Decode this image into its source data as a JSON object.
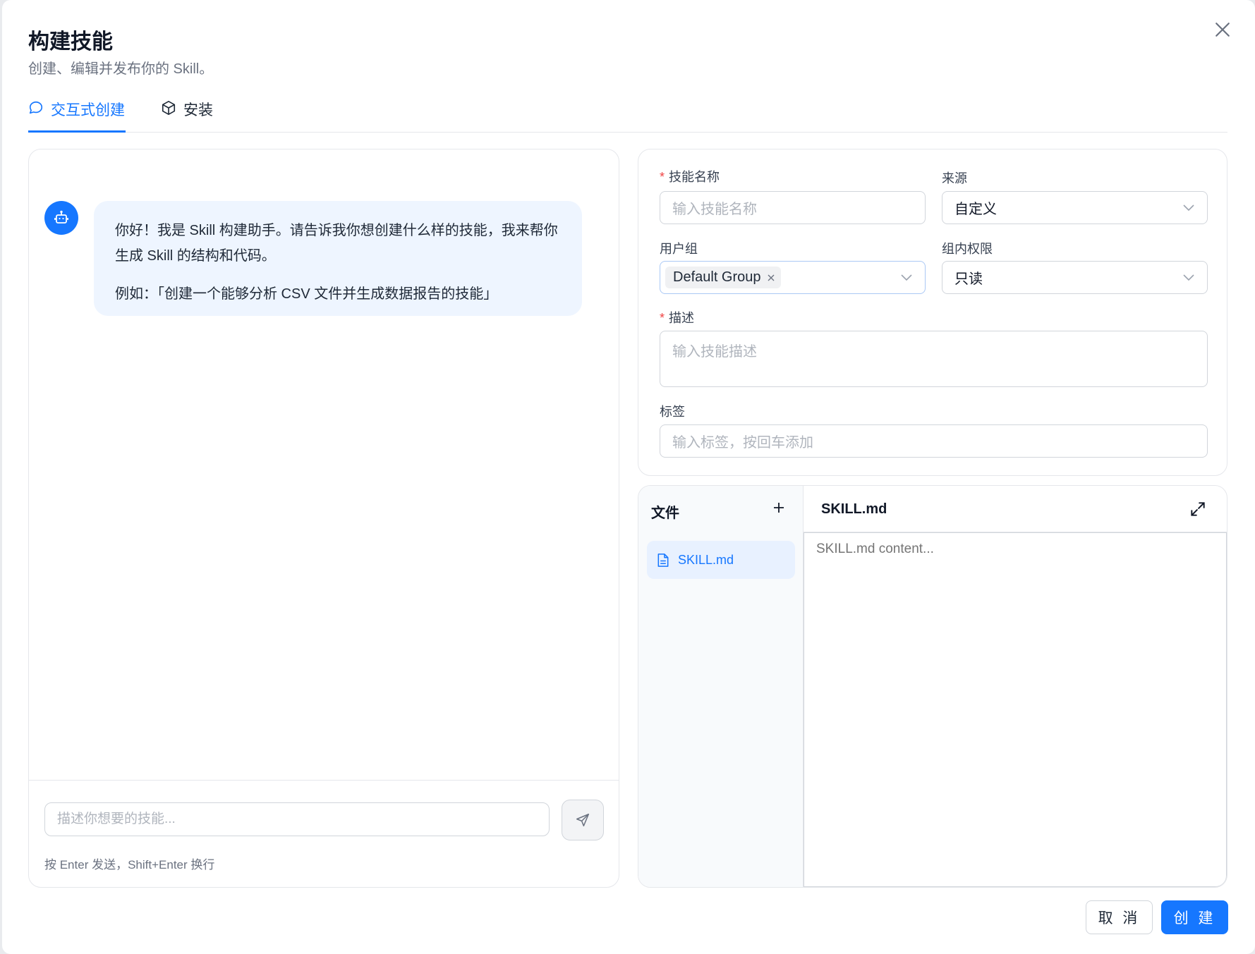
{
  "dialog": {
    "title": "构建技能",
    "subtitle": "创建、编辑并发布你的 Skill。"
  },
  "tabs": [
    {
      "label": "交互式创建",
      "icon": "chat-bubble-icon",
      "active": true
    },
    {
      "label": "安装",
      "icon": "package-icon",
      "active": false
    }
  ],
  "chat": {
    "message_line1": "你好！我是 Skill 构建助手。请告诉我你想创建什么样的技能，我来帮你生成 Skill 的结构和代码。",
    "message_line2": "例如：「创建一个能够分析 CSV 文件并生成数据报告的技能」",
    "input_placeholder": "描述你想要的技能...",
    "hint": "按 Enter 发送，Shift+Enter 换行"
  },
  "form": {
    "name_label": "技能名称",
    "name_placeholder": "输入技能名称",
    "source_label": "来源",
    "source_value": "自定义",
    "group_label": "用户组",
    "group_tag": "Default Group",
    "permission_label": "组内权限",
    "permission_value": "只读",
    "desc_label": "描述",
    "desc_placeholder": "输入技能描述",
    "tags_label": "标签",
    "tags_placeholder": "输入标签，按回车添加"
  },
  "files": {
    "header": "文件",
    "items": [
      "SKILL.md"
    ],
    "editor_title": "SKILL.md",
    "editor_placeholder": "SKILL.md content..."
  },
  "footer": {
    "cancel": "取 消",
    "create": "创 建"
  },
  "colors": {
    "primary": "#1677ff",
    "required": "#ef4444"
  }
}
